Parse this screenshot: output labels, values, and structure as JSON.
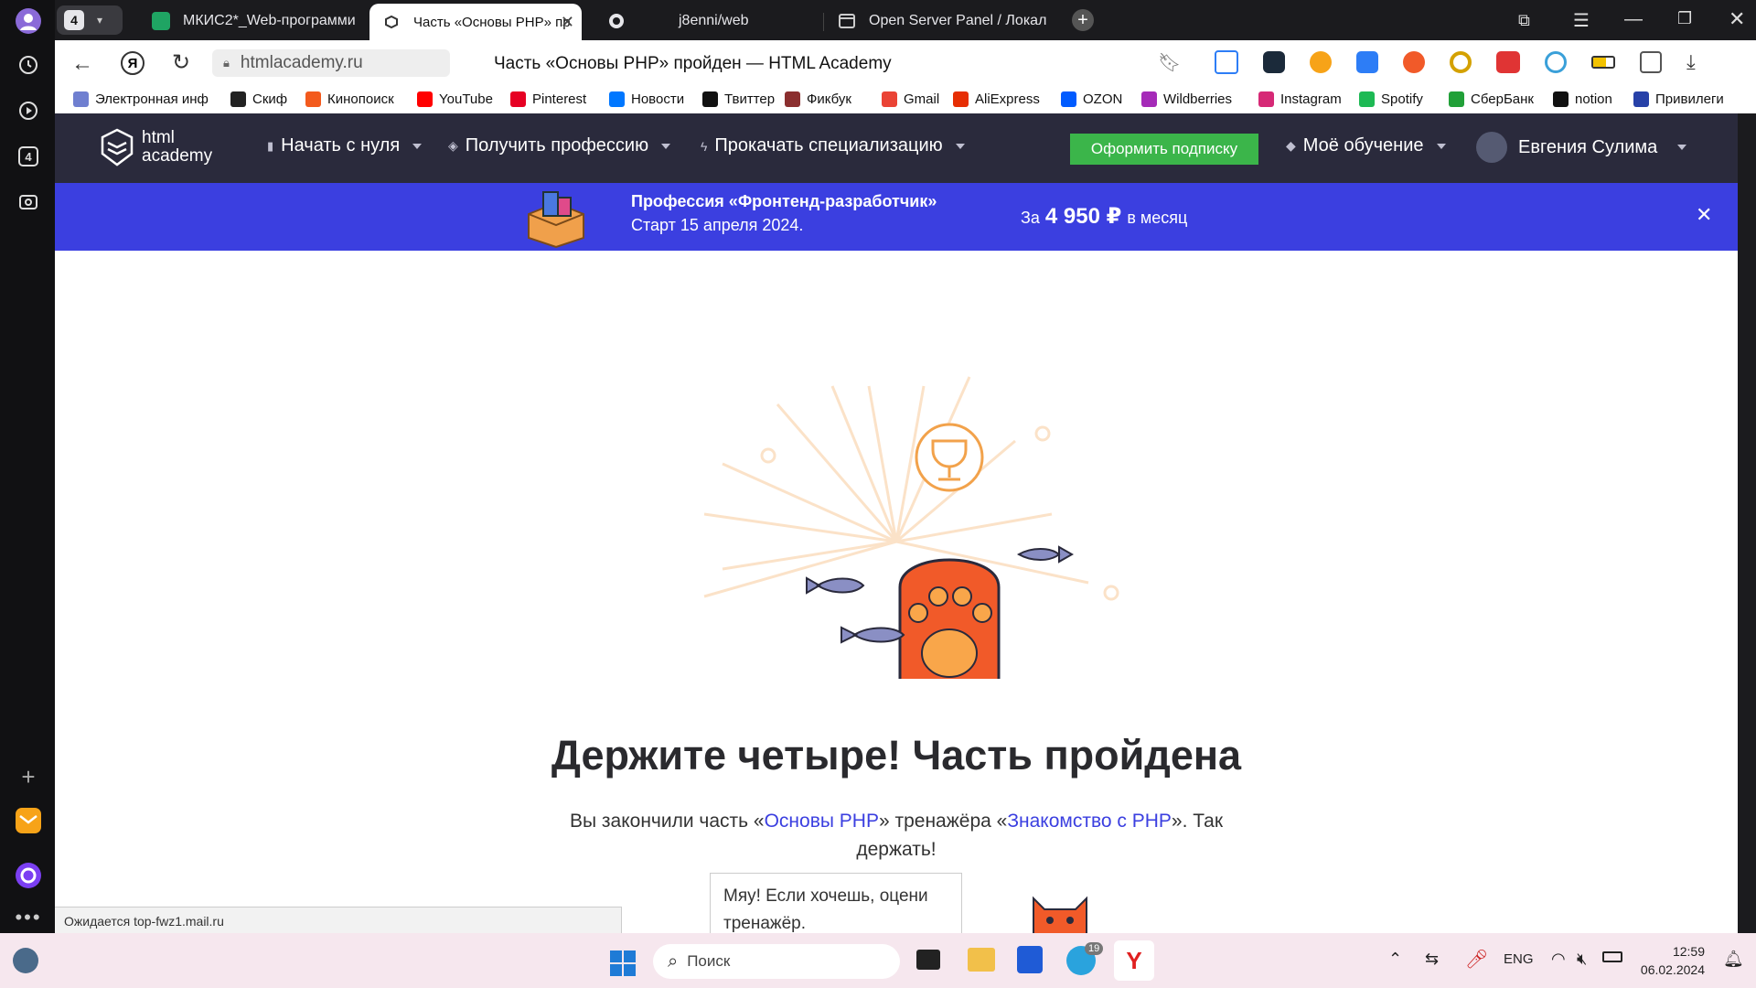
{
  "browser": {
    "tab_count": "4",
    "tabs": [
      {
        "title": "МКИС2*_Web-программи",
        "icon": "sheets-icon"
      },
      {
        "title": "Часть «Основы PHP» пр",
        "icon": "htmlacademy-icon"
      },
      {
        "title": "j8enni/web",
        "icon": "github-icon"
      },
      {
        "title": "Open Server Panel / Локал",
        "icon": "window-icon"
      }
    ],
    "url": "htmlacademy.ru",
    "page_title": "Часть «Основы PHP» пройден — HTML Academy",
    "bookmarks": [
      {
        "label": "Электронная инф",
        "color": "#6f7fd0"
      },
      {
        "label": "Скиф",
        "color": "#222222"
      },
      {
        "label": "Кинопоиск",
        "color": "#f35a1d"
      },
      {
        "label": "YouTube",
        "color": "#ff0000"
      },
      {
        "label": "Pinterest",
        "color": "#e60023"
      },
      {
        "label": "Новости",
        "color": "#0077ff"
      },
      {
        "label": "Твиттер",
        "color": "#111111"
      },
      {
        "label": "Фикбук",
        "color": "#8b2f2f"
      },
      {
        "label": "Gmail",
        "color": "#ea4335"
      },
      {
        "label": "AliExpress",
        "color": "#e62e04"
      },
      {
        "label": "OZON",
        "color": "#005bff"
      },
      {
        "label": "Wildberries",
        "color": "#a52bb8"
      },
      {
        "label": "Instagram",
        "color": "#d62976"
      },
      {
        "label": "Spotify",
        "color": "#1db954"
      },
      {
        "label": "СберБанк",
        "color": "#21a038"
      },
      {
        "label": "notion",
        "color": "#111111"
      },
      {
        "label": "Привилеги",
        "color": "#2741a8"
      }
    ]
  },
  "site": {
    "logo_line1": "html",
    "logo_line2": "academy",
    "nav": [
      "Начать с нуля",
      "Получить профессию",
      "Прокачать специализацию"
    ],
    "subscribe_label": "Оформить подписку",
    "my_learning_label": "Моё обучение",
    "user_name": "Евгения Сулима",
    "promo": {
      "title": "Профессия «Фронтенд-разработчик»",
      "subtitle": "Старт 15 апреля 2024.",
      "price_prefix": "За",
      "price": "4 950 ₽",
      "price_suffix": "в месяц"
    },
    "result": {
      "heading": "Держите четыре! Часть пройдена",
      "text_before": "Вы закончили часть «",
      "link1": "Основы PHP",
      "text_middle": "» тренажёра «",
      "link2": "Знакомство с PHP",
      "text_after": "». Так",
      "text_line2": "держать!",
      "speech": "Мяу! Если хочешь, оцени тренажёр."
    }
  },
  "status_text": "Ожидается top-fwz1.mail.ru",
  "taskbar": {
    "search_placeholder": "Поиск",
    "lang": "ENG",
    "time": "12:59",
    "date": "06.02.2024",
    "telegram_badge": "19"
  },
  "colors": {
    "nav_bg": "#2a2a3c",
    "promo_bg": "#3b3fe0",
    "subscribe_bg": "#3bb54a",
    "link": "#3b3fe0",
    "paw": "#f15a29"
  }
}
